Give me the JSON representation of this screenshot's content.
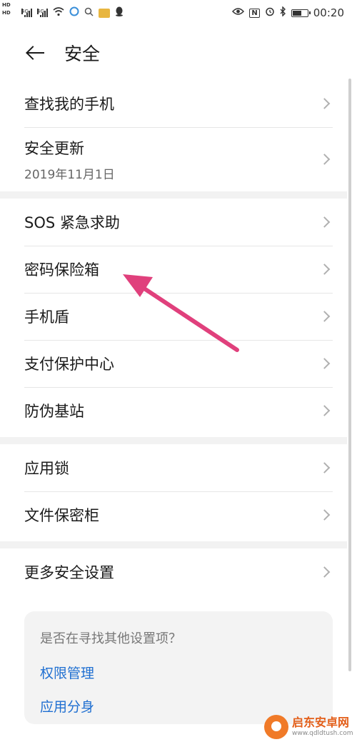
{
  "status_bar": {
    "hd_top": "HD",
    "hd_bottom": "HD",
    "sim1_label": "4G",
    "sim2_label": "4G",
    "nfc": "N",
    "time": "00:20",
    "battery_level": 0.55
  },
  "header": {
    "title": "安全"
  },
  "groups": [
    {
      "items": [
        {
          "label": "查找我的手机"
        },
        {
          "label": "安全更新",
          "sub": "2019年11月1日"
        }
      ]
    },
    {
      "items": [
        {
          "label": "SOS 紧急求助"
        },
        {
          "label": "密码保险箱"
        },
        {
          "label": "手机盾"
        },
        {
          "label": "支付保护中心"
        },
        {
          "label": "防伪基站"
        }
      ]
    },
    {
      "items": [
        {
          "label": "应用锁"
        },
        {
          "label": "文件保密柜"
        }
      ]
    },
    {
      "items": [
        {
          "label": "更多安全设置"
        }
      ]
    }
  ],
  "suggestion_card": {
    "title": "是否在寻找其他设置项？",
    "links": [
      "权限管理",
      "应用分身"
    ]
  },
  "watermark": {
    "name": "启东安卓网",
    "url": "www.qdldtush.com"
  },
  "colors": {
    "link": "#1f6fd1",
    "annotation_arrow": "#e0407c",
    "section_gap": "#f2f2f2"
  }
}
